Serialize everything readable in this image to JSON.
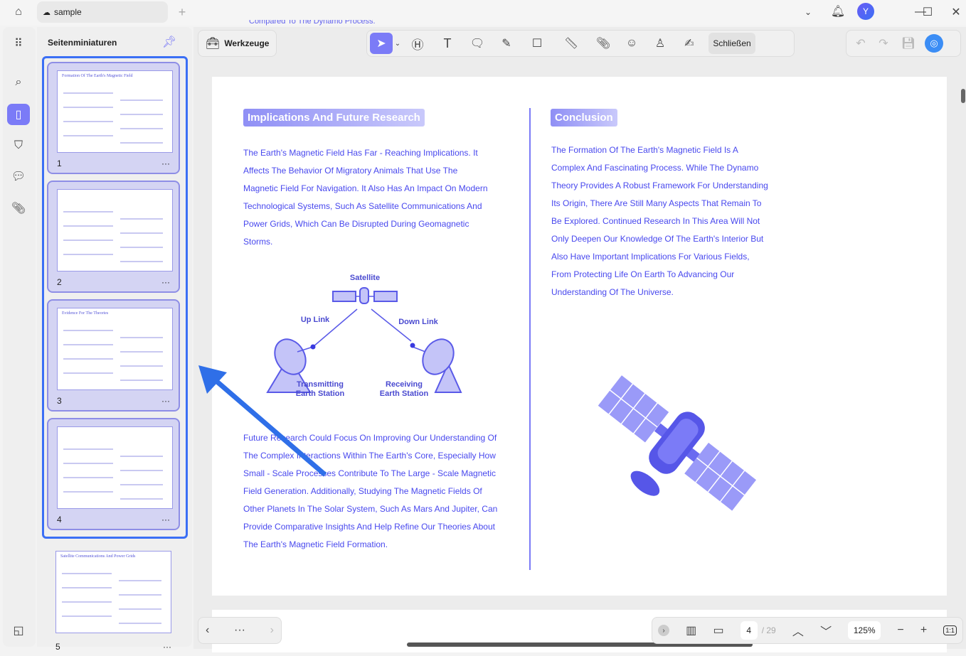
{
  "tab": {
    "title": "sample"
  },
  "sidebar": {
    "title": "Seitenminiaturen",
    "thumbnails": [
      {
        "page": "1",
        "heading": "Formation Of The Earth's Magnetic Field"
      },
      {
        "page": "2",
        "heading": ""
      },
      {
        "page": "3",
        "heading": "Evidence For The Theories"
      },
      {
        "page": "4",
        "heading": ""
      },
      {
        "page": "5",
        "heading": "Satellite Communications And Power Grids"
      }
    ],
    "more": "···"
  },
  "toolbar": {
    "tools_label": "Werkzeuge",
    "close_label": "Schließen"
  },
  "document": {
    "prev_line": "Compared To The Dynamo Process.",
    "left_heading": "Implications And Future Research",
    "left_para1": [
      "The Earth's Magnetic Field Has Far - Reaching Implications. It",
      "Affects The Behavior Of Migratory Animals That Use The",
      "Magnetic Field For Navigation. It Also Has An Impact On Modern",
      "Technological Systems, Such As Satellite Communications And",
      "Power Grids, Which Can Be Disrupted During Geomagnetic",
      "Storms."
    ],
    "diagram": {
      "satellite": "Satellite",
      "uplink": "Up Link",
      "downlink": "Down Link",
      "tx1": "Transmitting",
      "tx2": "Earth Station",
      "rx1": "Receiving",
      "rx2": "Earth Station"
    },
    "left_para2": [
      "Future Research Could Focus On Improving Our Understanding Of",
      "The Complex Interactions Within The Earth's Core, Especially How",
      "Small - Scale Processes Contribute To The Large - Scale Magnetic",
      "Field Generation. Additionally, Studying The Magnetic Fields Of",
      "Other Planets In The Solar System, Such As Mars And Jupiter, Can",
      "Provide Comparative Insights And Help Refine Our Theories About",
      "The Earth's Magnetic Field Formation."
    ],
    "right_heading": "Conclusion",
    "right_para": [
      "The Formation Of The Earth's Magnetic Field Is A",
      "Complex And Fascinating Process. While The Dynamo",
      "Theory Provides A Robust Framework For Understanding",
      "Its Origin, There Are Still Many Aspects That Remain To",
      "Be Explored. Continued Research In This Area Will Not",
      "Only Deepen Our Knowledge Of The Earth's Interior But",
      "Also Have Important Implications For Various Fields,",
      "From Protecting Life On Earth To Advancing Our",
      "Understanding Of The Universe."
    ]
  },
  "footer": {
    "page_current": "4",
    "page_total": "/ 29",
    "zoom": "125%",
    "fit": "1:1"
  },
  "user": {
    "avatar": "Y"
  },
  "colors": {
    "accent": "#7b7bf7",
    "text": "#4848ee",
    "selection": "#3b6ff5"
  }
}
